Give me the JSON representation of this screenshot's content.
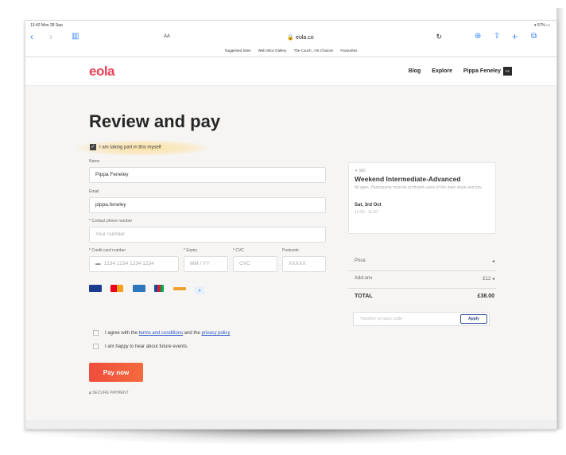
{
  "status": {
    "time": "13:42  Mon 28 Sep",
    "battery": "57%"
  },
  "browser": {
    "text_size": "AA",
    "url": "eola.co",
    "favourites": [
      "Suggested Sites",
      "Web Slice Gallery",
      "The Couch...HS Choices",
      "Favourites"
    ]
  },
  "site": {
    "logo": "eola",
    "nav": [
      "Blog",
      "Explore",
      "Pippa Feneley"
    ],
    "user_initials": "PF"
  },
  "form": {
    "title": "Review and pay",
    "taking_part": "I am taking part in this myself",
    "name_label": "Name",
    "name_value": "Pippa Feneley",
    "email_label": "Email",
    "email_value": "pippa.feneley",
    "phone_label": "* Contact phone number",
    "phone_placeholder": "Your number",
    "card_label": "* Credit card number",
    "card_placeholder": "1234 1234 1234 1234",
    "expiry_label": "* Expiry",
    "expiry_placeholder": "MM / YY",
    "cvc_label": "* CVC",
    "cvc_placeholder": "CVC",
    "postcode_label": "Postcode",
    "postcode_placeholder": "XXXXX",
    "terms_prefix": "I agree with the ",
    "terms_link": "terms and conditions",
    "terms_mid": " and the ",
    "privacy_link": "privacy policy",
    "future_events": "I am happy to hear about future events.",
    "pay_button": "Pay now",
    "secure": "SECURE PAYMENT"
  },
  "summary": {
    "category": "SKI",
    "event": "Weekend Intermediate-Advanced",
    "description": "All ages. Participants must be proficient users of the main slope and tow.",
    "date": "Sat, 3rd Oct",
    "time": "10:00 - 11:00",
    "price_label": "Price",
    "addons_label": "Add-ons",
    "addons_value": "£12",
    "total_label": "TOTAL",
    "total_value": "£38.00",
    "voucher_placeholder": "Voucher or pass code",
    "apply_button": "Apply"
  },
  "colors": {
    "brand": "#e94157",
    "pay": "#ef4d3d",
    "link": "#2a57c8"
  }
}
